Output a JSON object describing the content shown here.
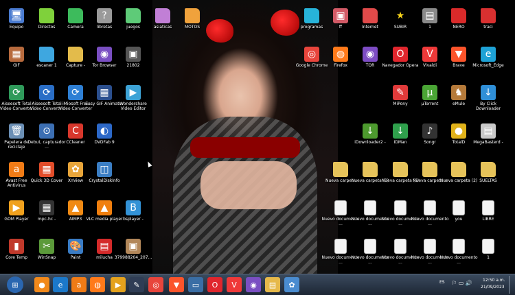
{
  "desktop": {
    "icons": [
      {
        "label": "Equipo",
        "name": "computer-icon",
        "glyph": "🖥",
        "bg": "#4a7bd0"
      },
      {
        "label": "Directos",
        "name": "folder-green-icon",
        "glyph": "",
        "bg": "#7fd13b"
      },
      {
        "label": "Camera",
        "name": "folder-green-icon",
        "glyph": "",
        "bg": "#3dbb5c"
      },
      {
        "label": "libretas",
        "name": "unknown-icon",
        "glyph": "?",
        "bg": "#9a9a9a"
      },
      {
        "label": "juegos",
        "name": "folder-green-icon",
        "glyph": "",
        "bg": "#5ecb78"
      },
      {
        "label": "asiaticas",
        "name": "folder-purple-icon",
        "glyph": "",
        "bg": "#c17fd6"
      },
      {
        "label": "MOTOS",
        "name": "folder-orange-icon",
        "glyph": "",
        "bg": "#f0a23c"
      },
      {
        "label": "programas",
        "name": "folder-teal-icon",
        "glyph": "",
        "bg": "#27b3d9"
      },
      {
        "label": "ff",
        "name": "image-file-icon",
        "glyph": "▣",
        "bg": "#d25a66"
      },
      {
        "label": "Internet",
        "name": "folder-red-icon",
        "glyph": "",
        "bg": "#e04a4a"
      },
      {
        "label": "SUBIR",
        "name": "star-icon",
        "glyph": "★",
        "bg": "transparent",
        "color": "#f6d21a"
      },
      {
        "label": "1",
        "name": "archive-icon",
        "glyph": "▤",
        "bg": "#8a8a8a"
      },
      {
        "label": "NERO",
        "name": "folder-red-icon",
        "glyph": "",
        "bg": "#d92a2a"
      },
      {
        "label": "traci",
        "name": "folder-red-icon",
        "glyph": "",
        "bg": "#d93030"
      },
      {
        "label": "GIF",
        "name": "image-file-icon",
        "glyph": "▦",
        "bg": "#b76a3d"
      },
      {
        "label": "escaner 1",
        "name": "folder-blue-icon",
        "glyph": "",
        "bg": "#3ea7e0"
      },
      {
        "label": "Capture -",
        "name": "folder-icon",
        "glyph": "",
        "bg": "#e3bb4b"
      },
      {
        "label": "Tor Browser",
        "name": "tor-browser-icon",
        "glyph": "◉",
        "bg": "#7a4fc2"
      },
      {
        "label": "21802",
        "name": "image-file-icon",
        "glyph": "▣",
        "bg": "#555"
      },
      {
        "label": "Google Chrome",
        "name": "chrome-icon",
        "glyph": "◎",
        "bg": "#e8453c"
      },
      {
        "label": "Firefox",
        "name": "firefox-icon",
        "glyph": "◍",
        "bg": "#ff7a1a"
      },
      {
        "label": "TOR",
        "name": "tor-icon",
        "glyph": "◉",
        "bg": "#7d4cc4"
      },
      {
        "label": "Navegador Opera",
        "name": "opera-icon",
        "glyph": "O",
        "bg": "#e0262d"
      },
      {
        "label": "Vivaldi",
        "name": "vivaldi-icon",
        "glyph": "V",
        "bg": "#ef3939"
      },
      {
        "label": "Brave",
        "name": "brave-icon",
        "glyph": "▼",
        "bg": "#fb542b"
      },
      {
        "label": "Microsoft_Edge",
        "name": "edge-icon",
        "glyph": "e",
        "bg": "#1ea2d6"
      },
      {
        "label": "Aiseesoft Total Video Converter",
        "name": "video-converter-icon",
        "glyph": "⟳",
        "bg": "#2f9a5a"
      },
      {
        "label": "Aiseesoft Total Video Converter",
        "name": "video-converter-icon",
        "glyph": "⟳",
        "bg": "#2a6ec6"
      },
      {
        "label": "iMiosoft Free Video Converter",
        "name": "video-converter-icon",
        "glyph": "⟳",
        "bg": "#2e7fd4"
      },
      {
        "label": "Easy GIF Animator",
        "name": "gif-animator-icon",
        "glyph": "▦",
        "bg": "#2b4f8e"
      },
      {
        "label": "Wondershare Video Editor",
        "name": "video-editor-icon",
        "glyph": "▶",
        "bg": "#3da3d6"
      },
      {
        "label": "MiPony",
        "name": "mipony-icon",
        "glyph": "✎",
        "bg": "#e03a3a"
      },
      {
        "label": "µTorrent",
        "name": "utorrent-icon",
        "glyph": "µ",
        "bg": "#4aa535"
      },
      {
        "label": "eMule",
        "name": "emule-icon",
        "glyph": "♞",
        "bg": "#b57a3a"
      },
      {
        "label": "By Click Downloader",
        "name": "byclick-icon",
        "glyph": "↓",
        "bg": "#2f8fd8"
      },
      {
        "label": "Papelera de reciclaje",
        "name": "recycle-bin-icon",
        "glyph": "🗑",
        "bg": "#6b8fb5"
      },
      {
        "label": "Debut, capturador ...",
        "name": "debut-icon",
        "glyph": "⊙",
        "bg": "#3c6fb3"
      },
      {
        "label": "CCleaner",
        "name": "ccleaner-icon",
        "glyph": "C",
        "bg": "#d8372c"
      },
      {
        "label": "DVDFab 9",
        "name": "dvdfab-icon",
        "glyph": "◐",
        "bg": "#2c68c8"
      },
      {
        "label": "iDownloader2 -",
        "name": "idownloader-icon",
        "glyph": "↓",
        "bg": "#4d9a2e"
      },
      {
        "label": "IDMan",
        "name": "idm-icon",
        "glyph": "↓",
        "bg": "#2fa04c"
      },
      {
        "label": "Songr",
        "name": "songr-icon",
        "glyph": "♪",
        "bg": "#333"
      },
      {
        "label": "TotalD",
        "name": "totald-icon",
        "glyph": "●",
        "bg": "#e0b21a"
      },
      {
        "label": "MegaBasterd -",
        "name": "megabasterd-icon",
        "glyph": "▤",
        "bg": "#c9c9c9"
      },
      {
        "label": "Avast Free Antivirus",
        "name": "avast-icon",
        "glyph": "a",
        "bg": "#f07b16"
      },
      {
        "label": "Quick 3D Cover",
        "name": "quick3d-icon",
        "glyph": "▦",
        "bg": "#e24d2a"
      },
      {
        "label": "XnView",
        "name": "xnview-icon",
        "glyph": "✿",
        "bg": "#e8a53a"
      },
      {
        "label": "CrystalDiskInfo",
        "name": "crystaldisk-icon",
        "glyph": "◫",
        "bg": "#3b7ec4"
      },
      {
        "label": "Nueva carpeta",
        "name": "folder-icon",
        "glyph": "",
        "bg": "#e6c35a"
      },
      {
        "label": "Nueva carpeta (3)",
        "name": "folder-icon",
        "glyph": "",
        "bg": "#e6c35a"
      },
      {
        "label": "Nueva carpeta (6)",
        "name": "folder-icon",
        "glyph": "",
        "bg": "#e6c35a"
      },
      {
        "label": "Nueva carpeta u",
        "name": "folder-icon",
        "glyph": "",
        "bg": "#e6c35a"
      },
      {
        "label": "Nueva carpeta (2)",
        "name": "folder-icon",
        "glyph": "",
        "bg": "#e6c35a"
      },
      {
        "label": "SUELTAS",
        "name": "folder-icon",
        "glyph": "",
        "bg": "#e6c35a"
      },
      {
        "label": "GOM Player",
        "name": "gom-player-icon",
        "glyph": "▶",
        "bg": "#f0a11e"
      },
      {
        "label": "mpc-hc -",
        "name": "mpc-hc-icon",
        "glyph": "▦",
        "bg": "#333"
      },
      {
        "label": "AIMP3",
        "name": "aimp-icon",
        "glyph": "▲",
        "bg": "#f08a14"
      },
      {
        "label": "VLC media player",
        "name": "vlc-icon",
        "glyph": "▲",
        "bg": "#f07f0e"
      },
      {
        "label": "bsplayer -",
        "name": "bsplayer-icon",
        "glyph": "B",
        "bg": "#3392d6"
      },
      {
        "label": "Nuevo documento ...",
        "name": "text-file-icon",
        "glyph": "",
        "bg": "doc"
      },
      {
        "label": "Nuevo documento ...",
        "name": "text-file-icon",
        "glyph": "",
        "bg": "doc"
      },
      {
        "label": "Nuevo documento ...",
        "name": "text-file-icon",
        "glyph": "",
        "bg": "doc"
      },
      {
        "label": "Nuevo documento ...",
        "name": "text-file-icon",
        "glyph": "",
        "bg": "doc"
      },
      {
        "label": "you",
        "name": "text-file-icon",
        "glyph": "",
        "bg": "doc"
      },
      {
        "label": "LIBRE",
        "name": "text-file-icon",
        "glyph": "",
        "bg": "doc"
      },
      {
        "label": "Core Temp",
        "name": "core-temp-icon",
        "glyph": "▮",
        "bg": "#c0392b"
      },
      {
        "label": "WinSnap",
        "name": "winsnap-icon",
        "glyph": "✂",
        "bg": "#5b9a3a"
      },
      {
        "label": "Paint",
        "name": "paint-icon",
        "glyph": "🎨",
        "bg": "#3a7cc4"
      },
      {
        "label": "milucha",
        "name": "pdf-file-icon",
        "glyph": "▤",
        "bg": "#d42a2a"
      },
      {
        "label": "379988204_207...",
        "name": "image-file-icon",
        "glyph": "▣",
        "bg": "#b2875a"
      },
      {
        "label": "Nuevo documento ...",
        "name": "text-file-icon",
        "glyph": "",
        "bg": "doc"
      },
      {
        "label": "Nuevo documento ...",
        "name": "text-file-icon",
        "glyph": "",
        "bg": "doc"
      },
      {
        "label": "Nuevo documento ...",
        "name": "text-file-icon",
        "glyph": "",
        "bg": "doc"
      },
      {
        "label": "Nuevo documento ...",
        "name": "text-file-icon",
        "glyph": "",
        "bg": "doc"
      },
      {
        "label": "Nuevo documento ...",
        "name": "text-file-icon",
        "glyph": "",
        "bg": "doc"
      },
      {
        "label": "1",
        "name": "text-file-icon",
        "glyph": "",
        "bg": "doc"
      }
    ]
  },
  "taskbar": {
    "items": [
      {
        "name": "start-button",
        "glyph": "⊞",
        "bg": "#2a66b0"
      },
      {
        "name": "firefox-orb-icon",
        "glyph": "●",
        "bg": "#f2891b"
      },
      {
        "name": "internet-explorer-icon",
        "glyph": "e",
        "bg": "#1b78c9"
      },
      {
        "name": "avast-taskbar-icon",
        "glyph": "a",
        "bg": "#f07b16"
      },
      {
        "name": "firefox-taskbar-icon",
        "glyph": "◍",
        "bg": "#ff7a1a"
      },
      {
        "name": "media-player-taskbar-icon",
        "glyph": "▶",
        "bg": "#e4a21d"
      },
      {
        "name": "pen-taskbar-icon",
        "glyph": "✎",
        "bg": "#2f3d55"
      },
      {
        "name": "chrome-taskbar-icon",
        "glyph": "◎",
        "bg": "#e8453c"
      },
      {
        "name": "brave-taskbar-icon",
        "glyph": "▼",
        "bg": "#fb542b"
      },
      {
        "name": "window-taskbar-icon",
        "glyph": "▭",
        "bg": "#3a6ea5"
      },
      {
        "name": "opera-taskbar-icon",
        "glyph": "O",
        "bg": "#e0262d"
      },
      {
        "name": "vivaldi-taskbar-icon",
        "glyph": "V",
        "bg": "#ef3939"
      },
      {
        "name": "tor-taskbar-icon",
        "glyph": "◉",
        "bg": "#7a4fc2"
      },
      {
        "name": "explorer-taskbar-icon",
        "glyph": "▤",
        "bg": "#e6b94a"
      },
      {
        "name": "paint-taskbar-icon",
        "glyph": "✿",
        "bg": "#4a8cd0"
      }
    ],
    "tray": {
      "language": "ES",
      "time": "12:50 a.m.",
      "date": "21/09/2023"
    }
  }
}
